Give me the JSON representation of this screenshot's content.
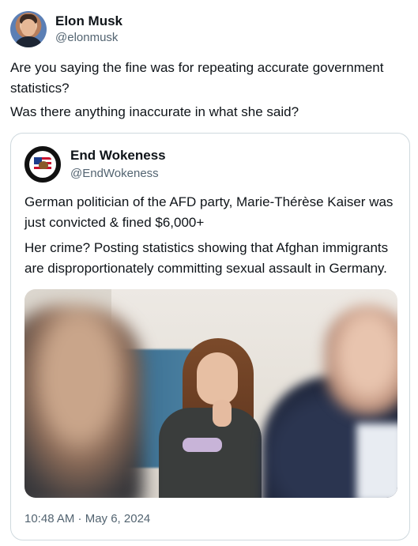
{
  "author": {
    "display_name": "Elon Musk",
    "handle": "@elonmusk",
    "avatar_icon": "profile-photo"
  },
  "post": {
    "paragraphs": [
      "Are you saying the fine was for repeating accurate government statistics?",
      "Was there anything inaccurate in what she said?"
    ]
  },
  "quoted": {
    "display_name": "End Wokeness",
    "handle": "@EndWokeness",
    "avatar_icon": "end-wokeness-logo",
    "paragraphs": [
      "German politician of the AFD party, Marie-Thérèse Kaiser was just convicted & fined $6,000+",
      "Her crime? Posting statistics showing that Afghan immigrants are disproportionately committing sexual assault in Germany."
    ],
    "media_icon": "photo",
    "timestamp": "10:48 AM · May 6, 2024"
  },
  "colors": {
    "text_primary": "#0f1419",
    "text_secondary": "#536471",
    "border": "#cfd9de"
  }
}
